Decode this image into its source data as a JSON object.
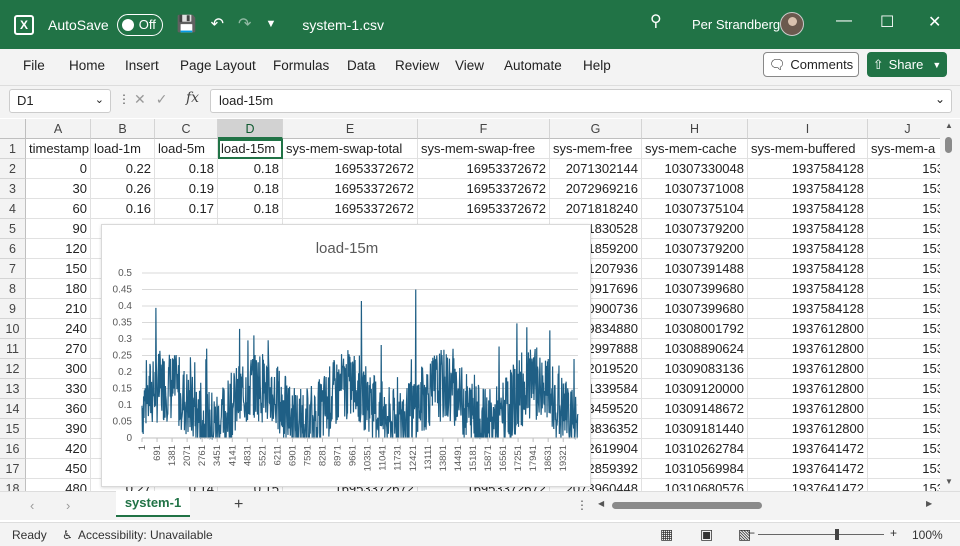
{
  "titlebar": {
    "app_icon": "excel-logo-icon",
    "autosave_label": "AutoSave",
    "autosave_state": "Off",
    "file_name": "system-1.csv",
    "user_name": "Per Strandberg"
  },
  "menu": [
    "File",
    "Home",
    "Insert",
    "Page Layout",
    "Formulas",
    "Data",
    "Review",
    "View",
    "Automate",
    "Help"
  ],
  "comments_label": "Comments",
  "share_label": "Share",
  "namebox": "D1",
  "formula": "load-15m",
  "columns": [
    "A",
    "B",
    "C",
    "D",
    "E",
    "F",
    "G",
    "H",
    "I",
    "J"
  ],
  "headers": [
    "timestamp",
    "load-1m",
    "load-5m",
    "load-15m",
    "sys-mem-swap-total",
    "sys-mem-swap-free",
    "sys-mem-free",
    "sys-mem-cache",
    "sys-mem-buffered",
    "sys-mem-a"
  ],
  "rows": [
    [
      "0",
      "0.22",
      "0.18",
      "0.18",
      "16953372672",
      "16953372672",
      "2071302144",
      "10307330048",
      "1937584128",
      "153"
    ],
    [
      "30",
      "0.26",
      "0.19",
      "0.18",
      "16953372672",
      "16953372672",
      "2072969216",
      "10307371008",
      "1937584128",
      "153"
    ],
    [
      "60",
      "0.16",
      "0.17",
      "0.18",
      "16953372672",
      "16953372672",
      "2071818240",
      "10307375104",
      "1937584128",
      "153"
    ],
    [
      "90",
      "",
      "",
      "",
      "",
      "",
      "2071830528",
      "10307379200",
      "1937584128",
      "153"
    ],
    [
      "120",
      "",
      "",
      "",
      "",
      "",
      "2071859200",
      "10307379200",
      "1937584128",
      "153"
    ],
    [
      "150",
      "",
      "",
      "",
      "",
      "",
      "2071207936",
      "10307391488",
      "1937584128",
      "153"
    ],
    [
      "180",
      "",
      "",
      "",
      "",
      "",
      "2070917696",
      "10307399680",
      "1937584128",
      "153"
    ],
    [
      "210",
      "",
      "",
      "",
      "",
      "",
      "2070900736",
      "10307399680",
      "1937584128",
      "153"
    ],
    [
      "240",
      "",
      "",
      "",
      "",
      "",
      "2069834880",
      "10308001792",
      "1937612800",
      "153"
    ],
    [
      "270",
      "",
      "",
      "",
      "",
      "",
      "2072997888",
      "10308890624",
      "1937612800",
      "153"
    ],
    [
      "300",
      "",
      "",
      "",
      "",
      "",
      "2072019520",
      "10309083136",
      "1937612800",
      "153"
    ],
    [
      "330",
      "",
      "",
      "",
      "",
      "",
      "2071339584",
      "10309120000",
      "1937612800",
      "153"
    ],
    [
      "360",
      "",
      "",
      "",
      "",
      "",
      "2073459520",
      "10309148672",
      "1937612800",
      "153"
    ],
    [
      "390",
      "",
      "",
      "",
      "",
      "",
      "2073836352",
      "10309181440",
      "1937612800",
      "153"
    ],
    [
      "420",
      "",
      "",
      "",
      "",
      "",
      "2072619904",
      "10310262784",
      "1937641472",
      "153"
    ],
    [
      "450",
      "",
      "",
      "",
      "",
      "",
      "2072859392",
      "10310569984",
      "1937641472",
      "153"
    ],
    [
      "480",
      "0.27",
      "0.14",
      "0.15",
      "16953372672",
      "16953372672",
      "2073960448",
      "10310680576",
      "1937641472",
      "153"
    ]
  ],
  "sheet_tab": "system-1",
  "status": {
    "ready": "Ready",
    "accessibility": "Accessibility: Unavailable",
    "zoom": "100%"
  },
  "chart_data": {
    "type": "line",
    "title": "load-15m",
    "ylim": [
      0,
      0.5
    ],
    "yticks": [
      "0",
      "0.05",
      "0.1",
      "0.15",
      "0.2",
      "0.25",
      "0.3",
      "0.35",
      "0.4",
      "0.45",
      "0.5"
    ],
    "xticks": [
      "1",
      "691",
      "1381",
      "2071",
      "2761",
      "3451",
      "4141",
      "4831",
      "5521",
      "6211",
      "6901",
      "7591",
      "8281",
      "8971",
      "9661",
      "10351",
      "11041",
      "11731",
      "12421",
      "13111",
      "13801",
      "14491",
      "15181",
      "15871",
      "16561",
      "17251",
      "17941",
      "18631",
      "19321"
    ],
    "n_points": 20000,
    "series_color": "#1f5f85",
    "grid": "horizontal"
  }
}
